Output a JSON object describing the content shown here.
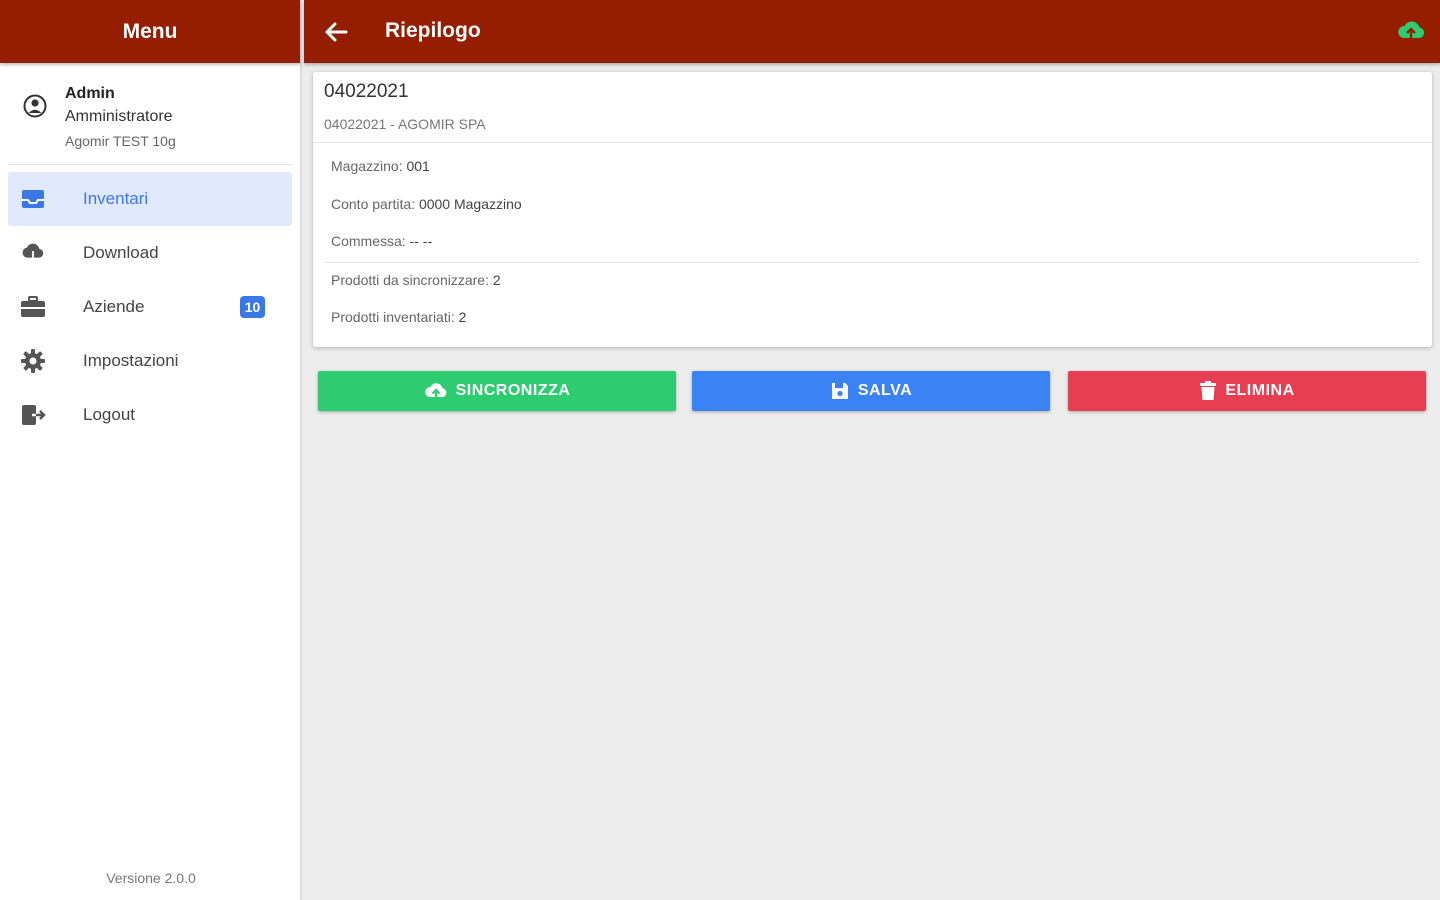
{
  "sidebar": {
    "title": "Menu",
    "user": {
      "name": "Admin",
      "role": "Amministratore",
      "company": "Agomir TEST 10g"
    },
    "items": [
      {
        "label": "Inventari",
        "icon": "inbox-icon",
        "active": true
      },
      {
        "label": "Download",
        "icon": "cloud-download-icon"
      },
      {
        "label": "Aziende",
        "icon": "briefcase-icon",
        "badge": "10"
      },
      {
        "label": "Impostazioni",
        "icon": "gear-icon"
      },
      {
        "label": "Logout",
        "icon": "logout-icon"
      }
    ],
    "version": "Versione 2.0.0"
  },
  "topbar": {
    "title": "Riepilogo",
    "status_icon": "cloud-sync-icon",
    "status_color": "#2ecc71"
  },
  "summary": {
    "title": "04022021",
    "subtitle": "04022021 - AGOMIR SPA",
    "warehouse_label": "Magazzino:",
    "warehouse_value": "001",
    "account_label": "Conto partita:",
    "account_value": "0000 Magazzino",
    "order_label": "Commessa:",
    "order_value": "-- --",
    "to_sync_label": "Prodotti da sincronizzare:",
    "to_sync_value": "2",
    "inventoried_label": "Prodotti inventariati:",
    "inventoried_value": "2"
  },
  "actions": {
    "sync_label": "SINCRONIZZA",
    "save_label": "SALVA",
    "delete_label": "ELIMINA"
  },
  "colors": {
    "header": "#961e00",
    "accent": "#3b78e7",
    "sync": "#2ecc71",
    "save": "#3b82f6",
    "delete": "#e63e52"
  }
}
